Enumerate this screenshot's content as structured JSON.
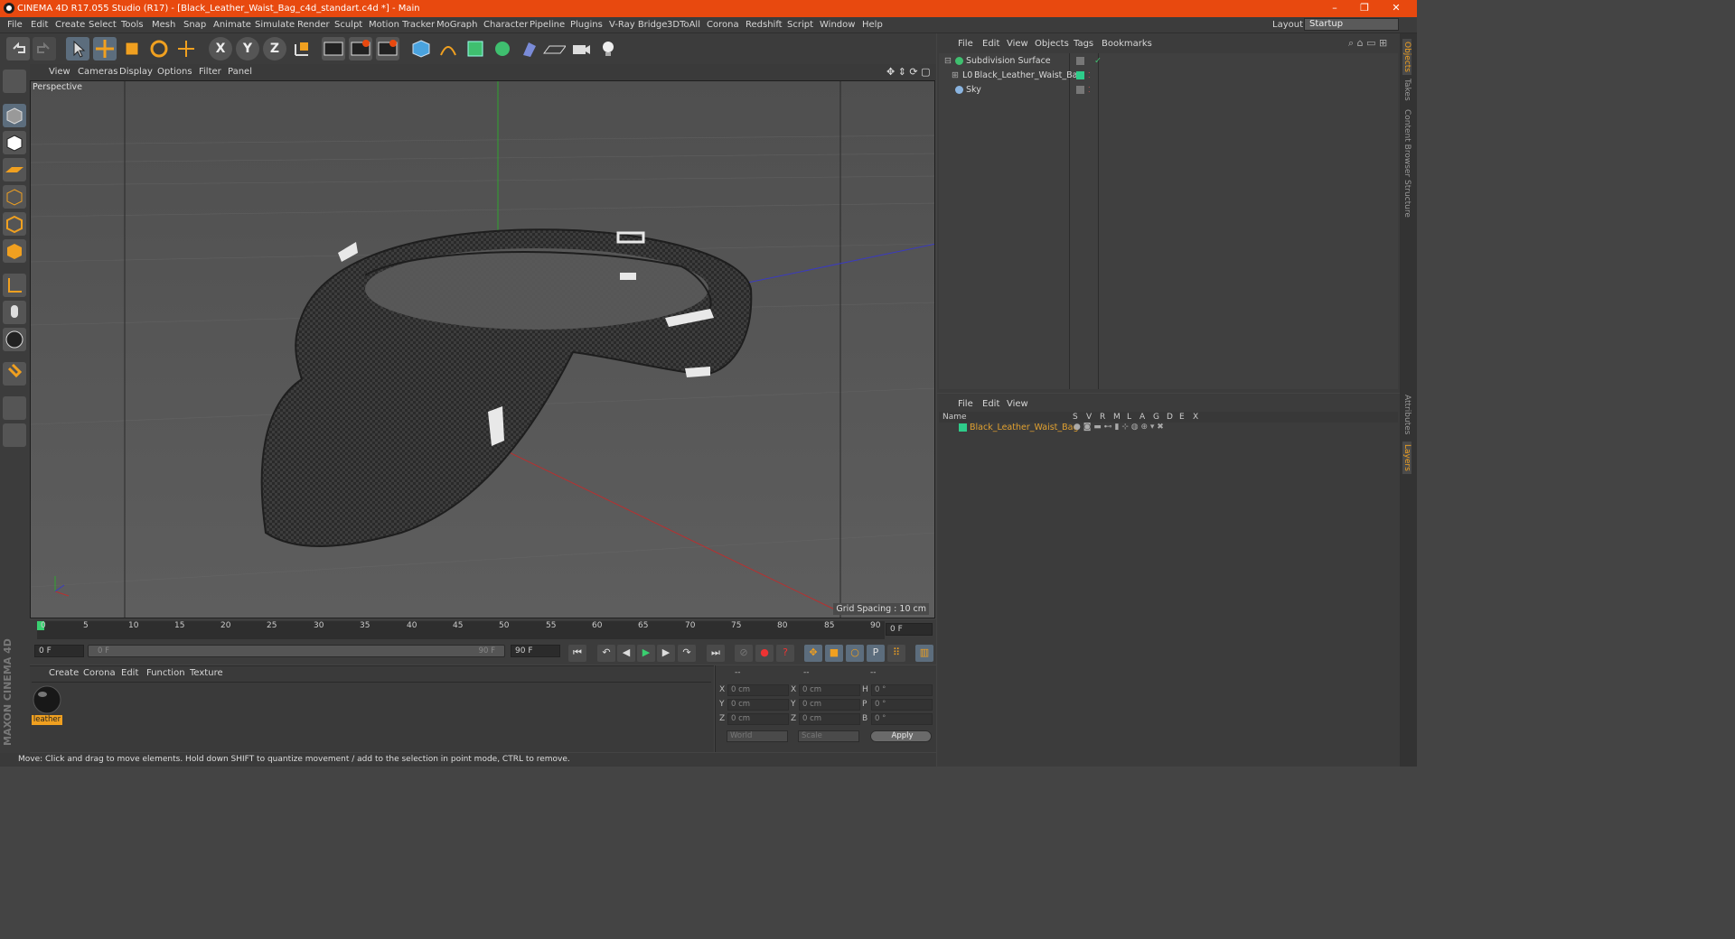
{
  "window": {
    "title": "CINEMA 4D R17.055 Studio (R17) - [Black_Leather_Waist_Bag_c4d_standart.c4d *] - Main",
    "minimize": "–",
    "restore": "❐",
    "close": "✕"
  },
  "menubar": {
    "items": [
      "File",
      "Edit",
      "Create",
      "Select",
      "Tools",
      "Mesh",
      "Snap",
      "Animate",
      "Simulate",
      "Render",
      "Sculpt",
      "Motion Tracker",
      "MoGraph",
      "Character",
      "Pipeline",
      "Plugins",
      "V-Ray Bridge",
      "3DToAll",
      "Corona",
      "Redshift",
      "Script",
      "Window",
      "Help"
    ],
    "layout_label": "Layout:",
    "layout_value": "Startup"
  },
  "toolbar": {
    "axis_x": "X",
    "axis_y": "Y",
    "axis_z": "Z"
  },
  "viewport": {
    "menu": [
      "View",
      "Cameras",
      "Display",
      "Options",
      "Filter",
      "Panel"
    ],
    "label": "Perspective",
    "grid_spacing": "Grid Spacing : 10 cm"
  },
  "timeline": {
    "ticks": [
      "0",
      "5",
      "10",
      "15",
      "20",
      "25",
      "30",
      "35",
      "40",
      "45",
      "50",
      "55",
      "60",
      "65",
      "70",
      "75",
      "80",
      "85",
      "90"
    ],
    "current_frame": "0 F"
  },
  "transport": {
    "start": "0 F",
    "range_start": "0 F",
    "range_end": "90 F",
    "end": "90 F"
  },
  "material_panel": {
    "menu": [
      "Create",
      "Corona",
      "Edit",
      "Function",
      "Texture"
    ],
    "material_name": "leather"
  },
  "coords": {
    "header": [
      "--",
      "--",
      "--"
    ],
    "rows": [
      {
        "a": "X",
        "av": "0 cm",
        "b": "X",
        "bv": "0 cm",
        "c": "H",
        "cv": "0 °"
      },
      {
        "a": "Y",
        "av": "0 cm",
        "b": "Y",
        "bv": "0 cm",
        "c": "P",
        "cv": "0 °"
      },
      {
        "a": "Z",
        "av": "0 cm",
        "b": "Z",
        "bv": "0 cm",
        "c": "B",
        "cv": "0 °"
      }
    ],
    "space": "World",
    "mode": "Scale",
    "apply": "Apply"
  },
  "status": "Move: Click and drag to move elements. Hold down SHIFT to quantize movement / add to the selection in point mode, CTRL to remove.",
  "maxon": "MAXON CINEMA 4D",
  "objects": {
    "menu": [
      "File",
      "Edit",
      "View",
      "Objects",
      "Tags",
      "Bookmarks"
    ],
    "items": [
      "Subdivision Surface",
      "Black_Leather_Waist_Bag",
      "Sky"
    ]
  },
  "layers": {
    "menu": [
      "File",
      "Edit",
      "View"
    ],
    "columns": [
      "Name",
      "S",
      "V",
      "R",
      "M",
      "L",
      "A",
      "G",
      "D",
      "E",
      "X"
    ],
    "items": [
      "Black_Leather_Waist_Bag"
    ]
  },
  "side_tabs": [
    "Objects",
    "Takes",
    "Content Browser",
    "Structure",
    "Attributes",
    "Layers"
  ],
  "colors": {
    "accent": "#e8490f",
    "layer_color": "#2ecc8a",
    "layer_text": "#e0a030"
  }
}
